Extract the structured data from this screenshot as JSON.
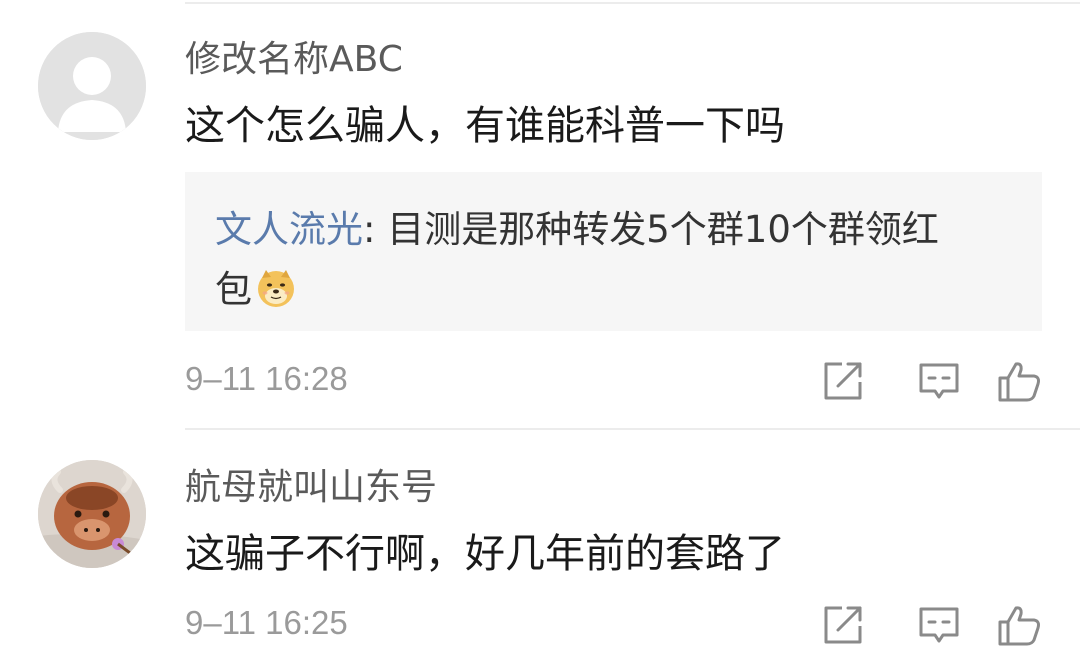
{
  "comments": [
    {
      "username": "修改名称ABC",
      "content": "这个怎么骗人，有谁能科普一下吗",
      "reply": {
        "author": "文人流光",
        "separator": ": ",
        "text_line1": "目测是那种转发5个群10个群领红",
        "text_line2": "包",
        "emoji": "doge-emoji"
      },
      "timestamp": "9–11 16:28"
    },
    {
      "username": "航母就叫山东号",
      "content": "这骗子不行啊，好几年前的套路了",
      "timestamp": "9–11 16:25"
    }
  ],
  "icons": {
    "share": "share-icon",
    "reply": "comment-icon",
    "like": "thumbs-up-icon"
  },
  "colors": {
    "reply_author": "#5a7bac",
    "username": "#5a5a5a",
    "content": "#1a1a1a",
    "timestamp": "#9a9a9a",
    "reply_bg": "#f6f6f6",
    "icon": "#8a8a8a"
  }
}
